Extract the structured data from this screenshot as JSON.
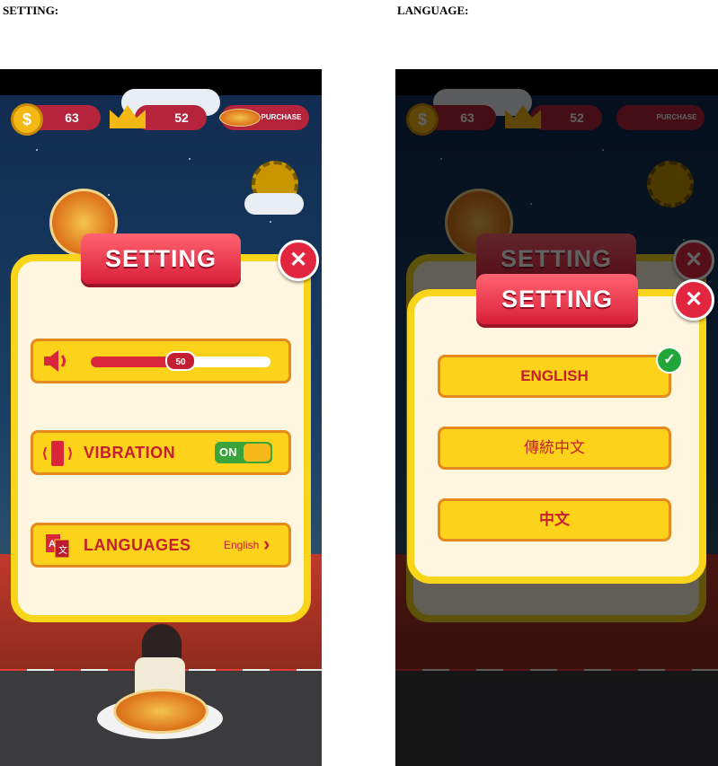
{
  "captions": {
    "setting": "SETTING:",
    "language": "LANGUAGE:"
  },
  "hud": {
    "coins": "63",
    "crowns": "52",
    "purchase_label": "PURCHASE"
  },
  "setting_panel": {
    "title": "SETTING",
    "volume_value": "50",
    "volume_level": 0.5,
    "vibration_label": "VIBRATION",
    "vibration_state": "ON",
    "languages_label": "LANGUAGES",
    "languages_value": "English"
  },
  "language_panel": {
    "title": "SETTING",
    "options": [
      "ENGLISH",
      "傳統中文",
      "中文"
    ],
    "selected": "ENGLISH"
  },
  "colors": {
    "accent_red": "#c4202f",
    "button_yellow": "#fcd21a",
    "panel_border": "#f8d51a",
    "check_green": "#22a63a"
  }
}
